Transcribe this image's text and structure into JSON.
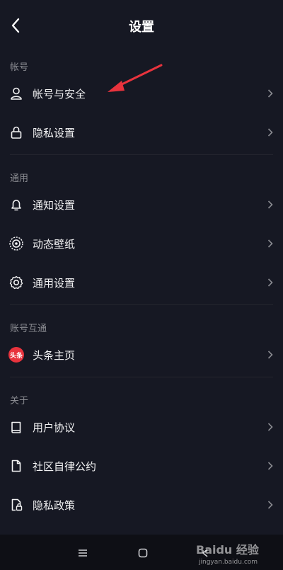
{
  "header": {
    "title": "设置"
  },
  "sections": {
    "account": {
      "header": "帐号",
      "items": [
        {
          "label": "帐号与安全",
          "icon": "user-icon"
        },
        {
          "label": "隐私设置",
          "icon": "lock-icon"
        }
      ]
    },
    "general": {
      "header": "通用",
      "items": [
        {
          "label": "通知设置",
          "icon": "bell-icon"
        },
        {
          "label": "动态壁纸",
          "icon": "wallpaper-icon"
        },
        {
          "label": "通用设置",
          "icon": "gear-icon"
        }
      ]
    },
    "interop": {
      "header": "账号互通",
      "items": [
        {
          "label": "头条主页",
          "icon": "toutiao-icon",
          "badge_text": "头条"
        }
      ]
    },
    "about": {
      "header": "关于",
      "items": [
        {
          "label": "用户协议",
          "icon": "book-icon"
        },
        {
          "label": "社区自律公约",
          "icon": "document-icon"
        },
        {
          "label": "隐私政策",
          "icon": "privacy-document-icon"
        }
      ]
    }
  },
  "watermark": {
    "brand": "Baidu 经验",
    "url": "jingyan.baidu.com"
  },
  "colors": {
    "background": "#161823",
    "text": "#f2f2f3",
    "muted": "#8a8b91",
    "annotation_arrow": "#e8333d"
  }
}
